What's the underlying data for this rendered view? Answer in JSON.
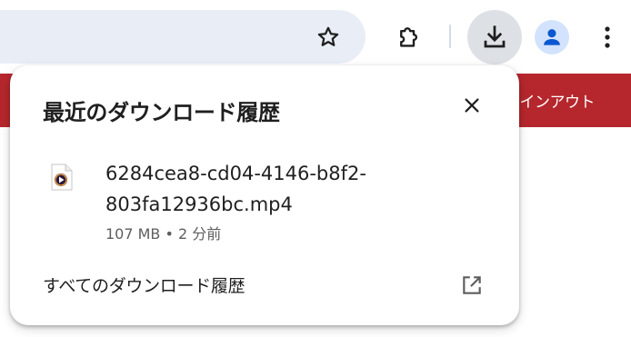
{
  "toolbar": {
    "icons": [
      "star-icon",
      "extension-icon",
      "download-icon",
      "profile-icon",
      "menu-icon"
    ],
    "colors": {
      "omnibox": "#e9eef6",
      "download_active_bg": "#dde1e6",
      "profile_bg": "#d3e3fd",
      "profile_fg": "#0b57d0"
    }
  },
  "page": {
    "signout_label": "サインアウト",
    "bar_color": "#b5272d"
  },
  "download_bubble": {
    "title": "最近のダウンロード履歴",
    "items": [
      {
        "filename": "6284cea8-cd04-4146-b8f2-803fa12936bc.mp4",
        "size": "107 MB",
        "separator": "•",
        "time": "2 分前",
        "icon": "video-file-icon"
      }
    ],
    "all_downloads_label": "すべてのダウンロード履歴",
    "open_icon": "open-in-new-icon"
  }
}
